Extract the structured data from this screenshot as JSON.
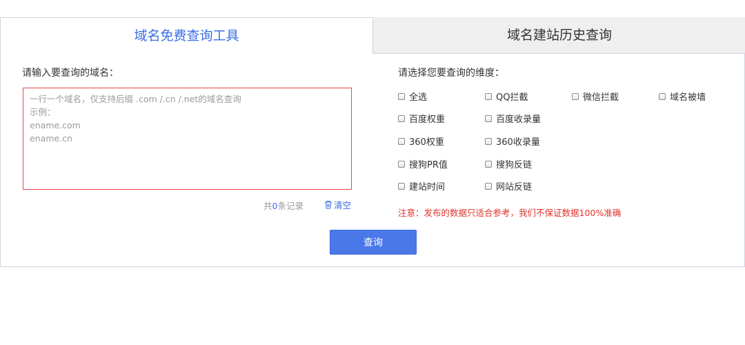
{
  "tabs": {
    "active_label": "域名免费查询工具",
    "inactive_label": "域名建站历史查询"
  },
  "left": {
    "label": "请输入要查询的域名：",
    "input_placeholder": "一行一个域名，仅支持后缀 .com /.cn /.net的域名查询\n示例：\nename.com\nename.cn",
    "count_prefix": "共",
    "count_value": "0",
    "count_suffix": "条记录",
    "clear_label": "清空"
  },
  "right": {
    "label": "请选择您要查询的维度：",
    "options": [
      "全选",
      "QQ拦截",
      "微信拦截",
      "域名被墙",
      "百度权重",
      "百度收录量",
      "360权重",
      "360收录量",
      "搜狗PR值",
      "搜狗反链",
      "建站时间",
      "网站反链"
    ],
    "notice": "注意：发布的数据只适合参考，我们不保证数据100%准确"
  },
  "query_button_label": "查询",
  "colors": {
    "accent": "#3a6ee6",
    "button": "#4a78e8",
    "input_border": "#e8454d",
    "notice": "#e0322b"
  }
}
